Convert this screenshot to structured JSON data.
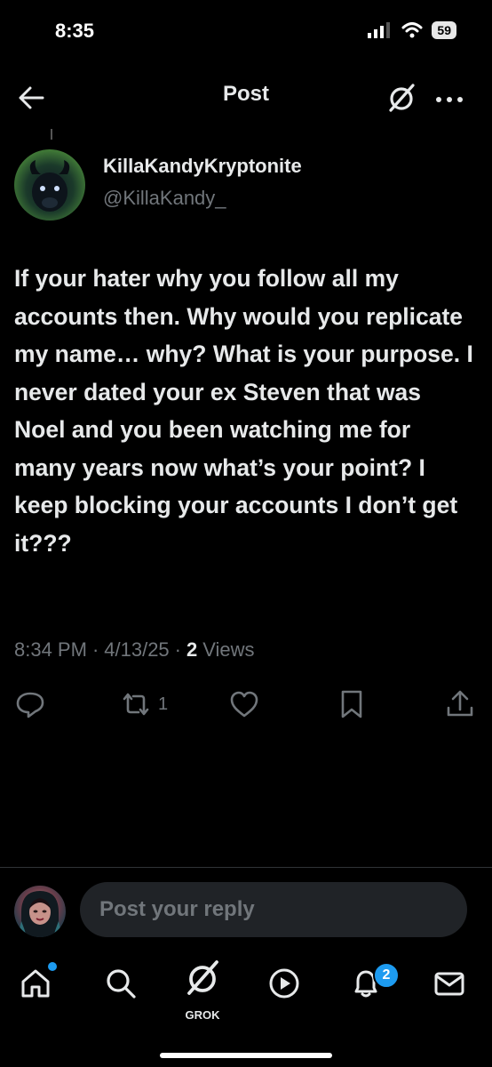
{
  "status_bar": {
    "time": "8:35",
    "battery": "59"
  },
  "header": {
    "title": "Post"
  },
  "author": {
    "display_name": "KillaKandyKryptonite",
    "handle": "@KillaKandy_"
  },
  "tweet": {
    "text": "If your hater why you follow all my accounts then. Why would you replicate my name… why? What is your purpose. I never dated your ex Steven that was Noel and you been watching me for many years now what’s your point? I keep blocking your accounts I don’t get it???",
    "time": "8:34 PM",
    "date": "4/13/25",
    "views_count": "2",
    "views_label": "Views",
    "separator": "·"
  },
  "actions": {
    "retweet_count": "1"
  },
  "reply": {
    "placeholder": "Post your reply"
  },
  "bottom_nav": {
    "grok_label": "GROK",
    "notifications_badge": "2"
  },
  "colors": {
    "accent": "#1d9bf0",
    "muted": "#71767b",
    "text": "#e7e9ea",
    "background": "#000000"
  },
  "icons": [
    "back-arrow-icon",
    "grok-icon",
    "more-icon",
    "reply-icon",
    "retweet-icon",
    "like-icon",
    "bookmark-icon",
    "share-icon",
    "home-icon",
    "search-icon",
    "video-icon",
    "bell-icon",
    "mail-icon"
  ]
}
